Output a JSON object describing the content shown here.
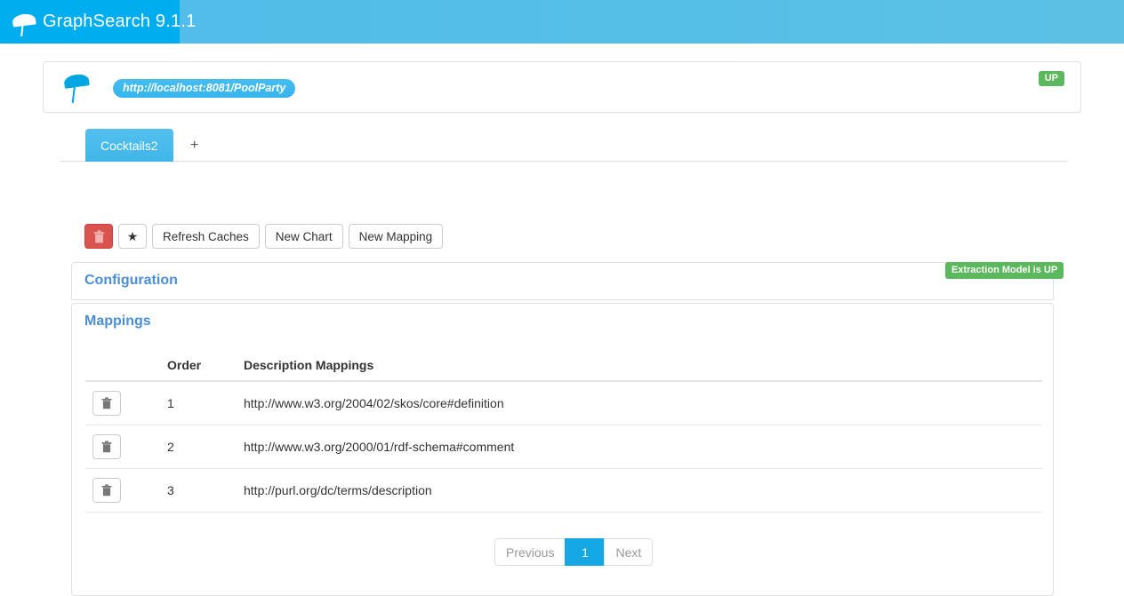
{
  "navbar": {
    "brand_title": "GraphSearch 9.1.1",
    "logo_icon": "umbrella-icon",
    "brand_bg": "#00aeef",
    "bar_bg": "#55bfe8"
  },
  "server_panel": {
    "logo_icon": "umbrella-icon",
    "url": "http://localhost:8081/PoolParty",
    "status_badge": "UP",
    "status_color": "#5cb85c"
  },
  "tabs": {
    "items": [
      {
        "label": "Cocktails2",
        "active": true
      },
      {
        "label": "+",
        "active": false
      }
    ]
  },
  "toolbar": {
    "delete_icon": "trash-icon",
    "favorite_icon": "star-icon",
    "favorite_glyph": "★",
    "refresh_caches_label": "Refresh Caches",
    "new_chart_label": "New Chart",
    "new_mapping_label": "New Mapping"
  },
  "configuration": {
    "title": "Configuration",
    "title_color": "#4a8fd4",
    "extraction_badge": "Extraction Model is UP",
    "extraction_badge_color": "#5cb85c"
  },
  "mappings": {
    "title": "Mappings",
    "title_color": "#4a8fd4",
    "columns": {
      "delete": "",
      "order": "Order",
      "description": "Description Mappings"
    },
    "rows": [
      {
        "delete_icon": "trash-icon",
        "order": "1",
        "description": "http://www.w3.org/2004/02/skos/core#definition"
      },
      {
        "delete_icon": "trash-icon",
        "order": "2",
        "description": "http://www.w3.org/2000/01/rdf-schema#comment"
      },
      {
        "delete_icon": "trash-icon",
        "order": "3",
        "description": "http://purl.org/dc/terms/description"
      }
    ],
    "pagination": {
      "previous_label": "Previous",
      "current_page": "1",
      "next_label": "Next",
      "active_color": "#16a7e5"
    }
  }
}
